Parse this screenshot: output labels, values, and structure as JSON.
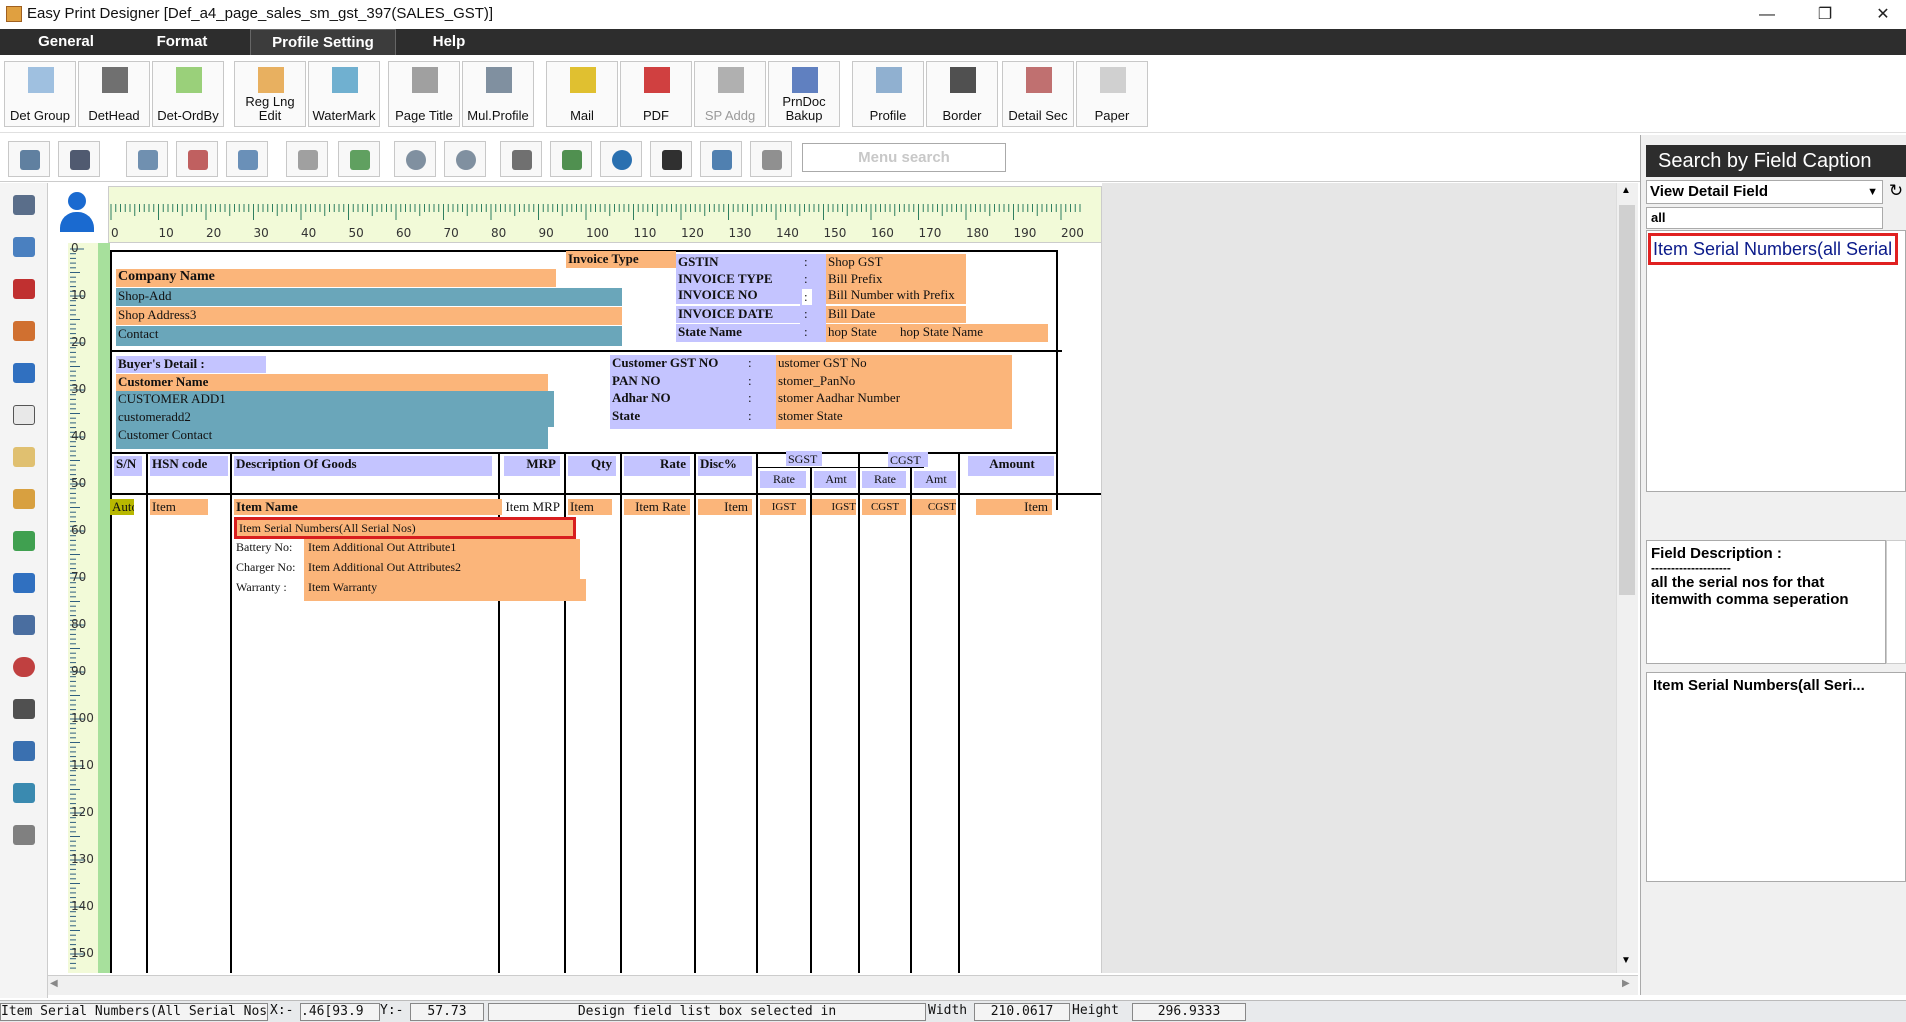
{
  "window": {
    "title": "Easy Print Designer [Def_a4_page_sales_sm_gst_397(SALES_GST)]"
  },
  "menu": [
    "General",
    "Format",
    "Profile Setting",
    "Help"
  ],
  "toolbar": [
    {
      "label": "Det Group",
      "enabled": true
    },
    {
      "label": "DetHead",
      "enabled": true
    },
    {
      "label": "Det-OrdBy",
      "enabled": true
    },
    {
      "label": "Reg Lng Edit",
      "enabled": true
    },
    {
      "label": "WaterMark",
      "enabled": true
    },
    {
      "label": "Page Title",
      "enabled": true
    },
    {
      "label": "Mul.Profile",
      "enabled": true
    },
    {
      "label": "Mail",
      "enabled": true
    },
    {
      "label": "PDF",
      "enabled": true
    },
    {
      "label": "SP Addg",
      "enabled": false
    },
    {
      "label": "PrnDoc Bakup",
      "enabled": true
    },
    {
      "label": "Profile",
      "enabled": true
    },
    {
      "label": "Border",
      "enabled": true
    },
    {
      "label": "Detail Sec",
      "enabled": true
    },
    {
      "label": "Paper",
      "enabled": true
    }
  ],
  "menu_search": {
    "placeholder": "Menu search"
  },
  "ruler": {
    "h": [
      "0",
      "10",
      "20",
      "30",
      "40",
      "50",
      "60",
      "70",
      "80",
      "90",
      "100",
      "110",
      "120",
      "130",
      "140",
      "150",
      "160",
      "170",
      "180",
      "190",
      "200"
    ],
    "v": [
      "0",
      "10",
      "20",
      "30",
      "40",
      "50",
      "60",
      "70",
      "80",
      "90",
      "100",
      "110",
      "120",
      "130",
      "140",
      "150"
    ]
  },
  "invoice": {
    "invoice_type": "Invoice Type",
    "company_name": "Company Name",
    "shop_add": "Shop-Add",
    "shop_address3": "Shop Address3",
    "contact": "Contact",
    "gstin_label": "GSTIN",
    "invoice_type_label": "INVOICE TYPE",
    "invoice_no_label": "INVOICE NO",
    "invoice_date_label": "INVOICE DATE",
    "state_name_label": "State Name",
    "colon": ":",
    "shop_gst": "Shop GST",
    "bill_prefix": "Bill Prefix",
    "bill_number": "Bill Number with Prefix",
    "bill_date": "Bill Date",
    "shop_state": "hop State",
    "shop_state_name": "hop State Name",
    "buyers_detail": "Buyer's Detail :",
    "customer_name": "Customer Name",
    "customer_add1": "CUSTOMER ADD1",
    "customer_add2": "customeradd2",
    "customer_contact": "Customer Contact",
    "cust_gst_label": "Customer GST NO",
    "pan_label": "PAN NO",
    "adhar_label": "Adhar NO",
    "state_label": "State",
    "cust_gst_val": "ustomer GST No",
    "pan_val": "stomer_PanNo",
    "adhar_val": "stomer Aadhar Number",
    "state_val": "stomer State"
  },
  "columns": {
    "sn": "S/N",
    "hsn": "HSN code",
    "desc": "Description Of Goods",
    "mrp": "MRP",
    "qty": "Qty",
    "rate": "Rate",
    "disc": "Disc%",
    "sgst": "SGST",
    "cgst": "CGST",
    "sub_rate": "Rate",
    "sub_amt": "Amt",
    "amount": "Amount"
  },
  "detail": {
    "auto": "Auto",
    "item": "Item",
    "item_name": "Item Name",
    "item_mrp": "Item MRP",
    "item_qty": "Item",
    "item_rate": "Item Rate",
    "item_disc": "Item",
    "igst1": "IGST",
    "igst2": "IGST",
    "cgst1": "CGST",
    "cgst2": "CGST",
    "item_amount": "Item",
    "serial": "Item Serial Numbers(All Serial Nos)",
    "battery_label": "Battery No:",
    "battery_val": "Item Additional Out Attribute1",
    "charger_label": "Charger No:",
    "charger_val": "Item Additional Out Attributes2",
    "warranty_label": "Warranty :",
    "warranty_val": "Item Warranty"
  },
  "right_panel": {
    "title": "Search by Field Caption",
    "combo": "View Detail Field",
    "filter": "all",
    "selected_item": "Item Serial Numbers(all Serial Nos)",
    "desc_title": "Field Description :",
    "desc_sep": "--------------------",
    "desc_text": "all the serial nos for that itemwith comma seperation",
    "field_name": "Item Serial Numbers(all Seri..."
  },
  "status": {
    "field": "Item Serial Numbers(All Serial Nos)",
    "x_label": "X:-",
    "x_value": ".46[93.9",
    "y_label": "Y:-",
    "y_value": "57.73",
    "message": "Design field list box selected in",
    "width_label": "Width",
    "width_value": "210.0617",
    "height_label": "Height",
    "height_value": "296.9333"
  }
}
